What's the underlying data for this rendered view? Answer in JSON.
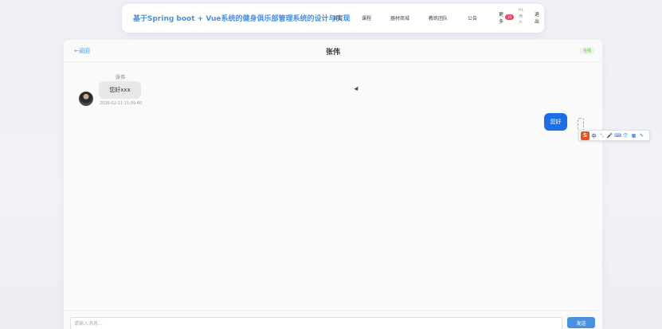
{
  "navbar": {
    "brand": "基于Spring boot + Vue系统的健身俱乐部管理系统的设计与实现",
    "items": [
      "首页",
      "课程",
      "器材商城",
      "教练团队",
      "公告"
    ],
    "more_label": "更多",
    "badge_count": "10",
    "user_label": "Hi,用户",
    "logout_label": "退出"
  },
  "chat": {
    "back_label": "←返回",
    "title": "张伟",
    "status": "在线",
    "messages": [
      {
        "sender": "张伟",
        "text": "您好xxx",
        "time": "2026-02-11 15:09:40",
        "side": "left"
      },
      {
        "sender": "",
        "text": "您好",
        "time": "",
        "side": "right"
      }
    ],
    "input_placeholder": "请输入消息...",
    "send_label": "发送"
  },
  "ime": {
    "logo": "S",
    "icons": [
      "中",
      "°,",
      "🎤",
      "⌨",
      "👕",
      "▦",
      "✎"
    ]
  },
  "colors": {
    "accent": "#4a90e2",
    "bubble_right": "#1b6fe3",
    "online": "#52c41a",
    "badge": "#e74c5c"
  }
}
